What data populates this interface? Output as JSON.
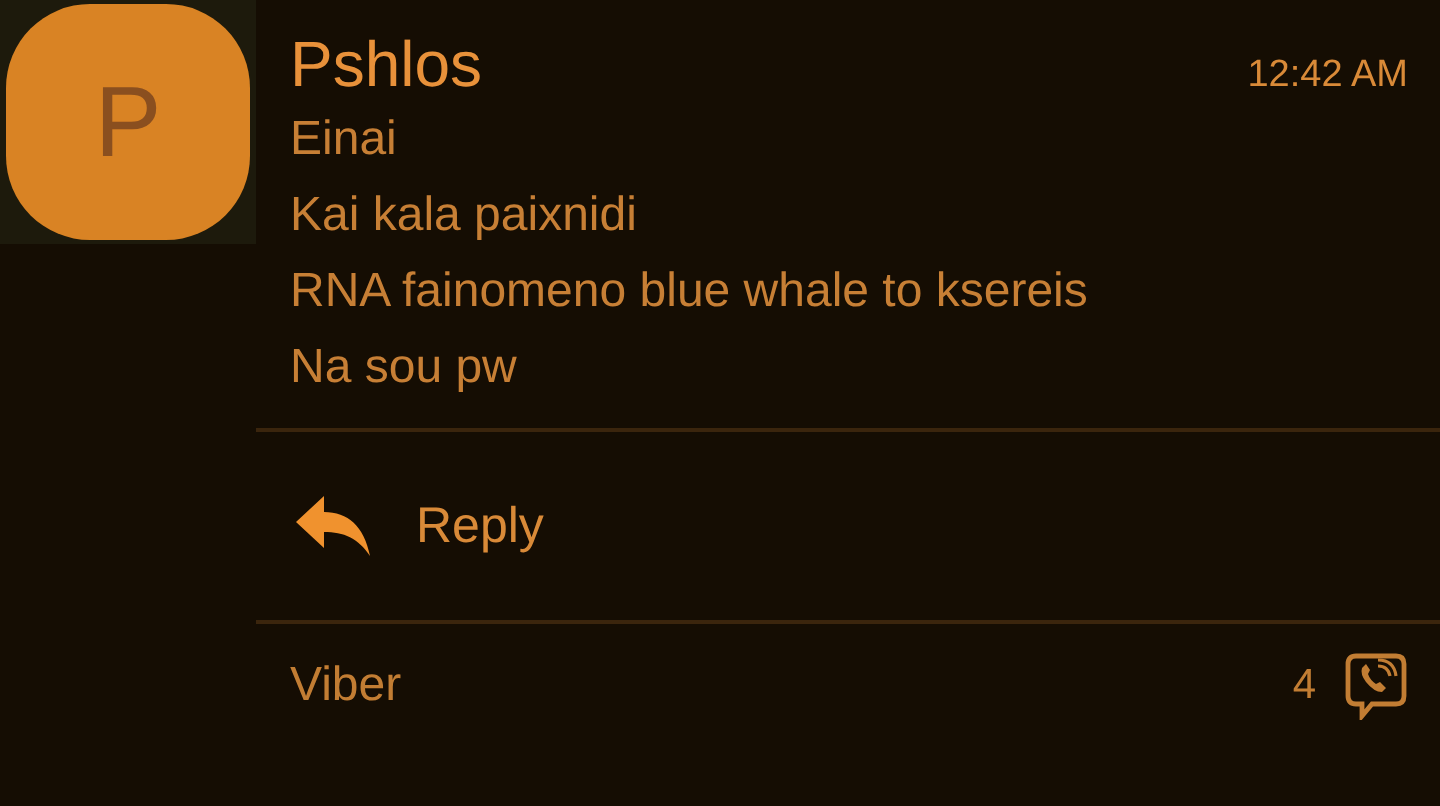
{
  "sender": {
    "initial": "P",
    "name": "Pshlos"
  },
  "time": "12:42 AM",
  "messages": [
    "Einai",
    "Kai kala paixnidi",
    "RNA fainomeno blue whale to ksereis",
    "Na sou pw"
  ],
  "action": {
    "label": "Reply"
  },
  "footer": {
    "app": "Viber",
    "count": "4"
  }
}
